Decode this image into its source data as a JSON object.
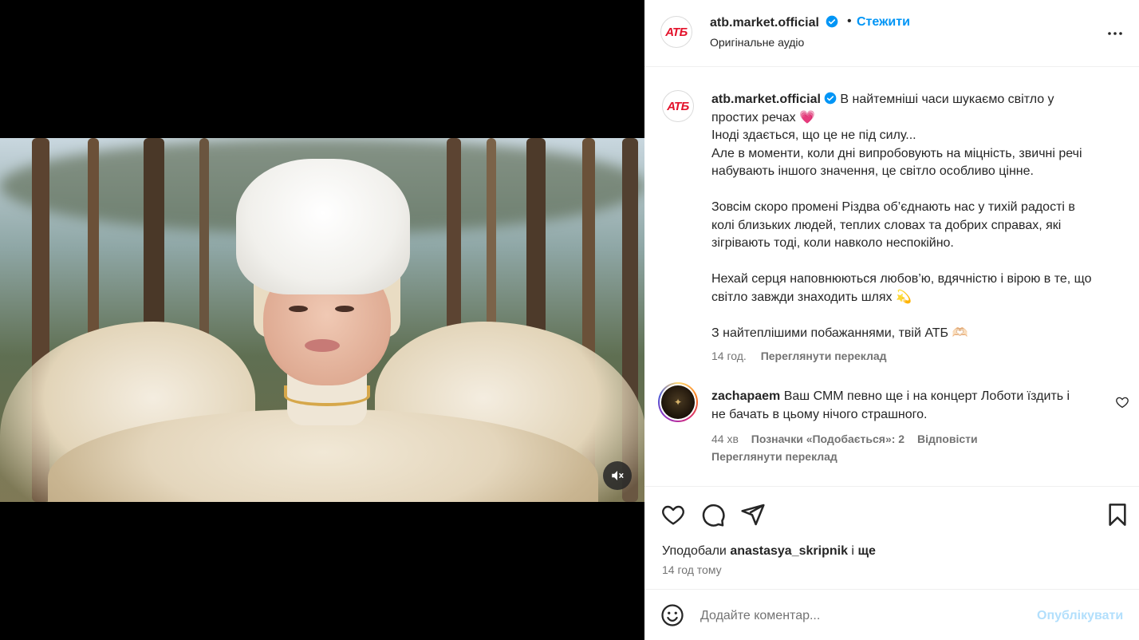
{
  "post": {
    "account": "atb.market.official",
    "avatar_text": "АТБ",
    "follow_label": "Стежити",
    "separator": "•",
    "audio": "Оригінальне аудіо"
  },
  "caption": {
    "username": "atb.market.official",
    "lines": [
      "В найтемніші часи шукаємо світло у",
      "простих речах 💗",
      "Іноді здається, що це не під силу...",
      "Але в моменти, коли дні випробовують на міцність, звичні речі",
      "набувають іншого значення, це світло особливо цінне.",
      "",
      "Зовсім скоро промені Різдва об’єднають нас у тихій радості в",
      "колі близьких людей, теплих словах та добрих справах, які",
      "зігрівають тоді, коли навколо неспокійно.",
      "",
      "Нехай серця наповнюються любов’ю, вдячністю і вірою в те, що",
      "світло завжди знаходить шлях 💫",
      "",
      "З найтеплішими побажаннями, твій АТБ 🫶🏻"
    ],
    "time": "14 год.",
    "translate": "Переглянути переклад"
  },
  "comment": {
    "username": "zachapaem",
    "text_line1": "Ваш СММ певно ще і на концерт Лоботи їздить і",
    "text_line2": "не бачать в цьому нічого страшного.",
    "time": "44 хв",
    "likes": "Позначки «Подобається»: 2",
    "reply": "Відповісти",
    "translate": "Переглянути переклад",
    "avatar_text": "✦"
  },
  "footer": {
    "liked_by_prefix": "Уподобали",
    "liked_by_user": "anastasya_skripnik",
    "liked_by_suffix": "і",
    "liked_by_more": "ще",
    "time_ago": "14 год тому",
    "comment_placeholder": "Додайте коментар...",
    "publish": "Опублікувати"
  },
  "colors": {
    "accent": "#0095f6",
    "brand": "#e3112a",
    "publish_disabled": "#b2dffc",
    "muted": "#737373"
  },
  "icons": [
    "verified-icon",
    "more-icon",
    "mute-icon",
    "heart-icon",
    "comment-icon",
    "share-icon",
    "bookmark-icon",
    "emoji-icon",
    "small-heart-icon"
  ]
}
